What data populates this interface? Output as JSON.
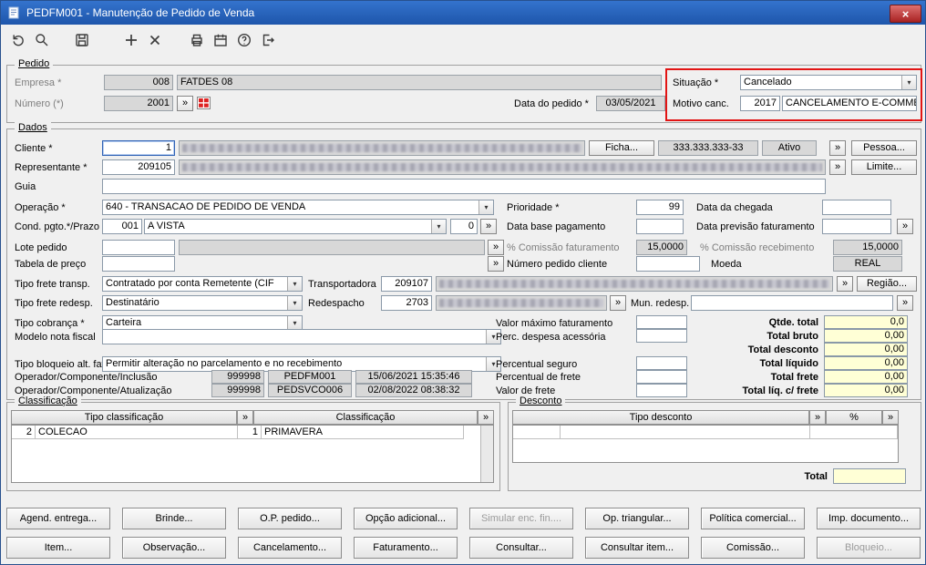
{
  "glyphs": {
    "more": "»",
    "chevron": "▾",
    "close": "×"
  },
  "window": {
    "title": "PEDFM001 - Manutenção de Pedido de Venda"
  },
  "toolbar": {
    "icons": [
      "undo-icon",
      "search-icon",
      "save-icon",
      "add-icon",
      "delete-icon",
      "print-icon",
      "calendar-icon",
      "help-icon",
      "exit-icon"
    ]
  },
  "pedido": {
    "title": "Pedido",
    "empresa_label": "Empresa *",
    "empresa_code": "008",
    "empresa_name": "FATDES 08",
    "numero_label": "Número (*)",
    "numero_value": "2001",
    "data_pedido_label": "Data do pedido *",
    "data_pedido_value": "03/05/2021",
    "situacao_label": "Situação *",
    "situacao_value": "Cancelado",
    "motivo_label": "Motivo canc.",
    "motivo_code": "2017",
    "motivo_text": "CANCELAMENTO E-COMMER"
  },
  "dados": {
    "title": "Dados",
    "cliente_label": "Cliente *",
    "cliente_code": "1",
    "ficha_button": "Ficha...",
    "cliente_documento": "333.333.333-33",
    "cliente_status": "Ativo",
    "pessoa_button": "Pessoa...",
    "representante_label": "Representante *",
    "representante_code": "209105",
    "limite_button": "Limite...",
    "guia_label": "Guia",
    "operacao_label": "Operação *",
    "operacao_value": "640 - TRANSACAO DE PEDIDO DE VENDA",
    "prioridade_label": "Prioridade *",
    "prioridade_value": "99",
    "data_chegada_label": "Data da chegada",
    "cond_pgto_label": "Cond. pgto.*/Prazo",
    "cond_pgto_code": "001",
    "cond_pgto_value": "A VISTA",
    "prazo_value": "0",
    "data_base_label": "Data base pagamento",
    "data_previsao_label": "Data previsão faturamento",
    "lote_label": "Lote pedido",
    "comissao_fat_label": "% Comissão faturamento",
    "comissao_fat_value": "15,0000",
    "comissao_rec_label": "% Comissão recebimento",
    "comissao_rec_value": "15,0000",
    "tabela_preco_label": "Tabela de preço",
    "num_pedido_cliente_label": "Número pedido cliente",
    "moeda_label": "Moeda",
    "moeda_value": "REAL",
    "frete_transp_label": "Tipo frete transp.",
    "frete_transp_value": "Contratado por conta Remetente (CIF",
    "transportadora_label": "Transportadora",
    "transportadora_code": "209107",
    "regiao_button": "Região...",
    "frete_redesp_label": "Tipo frete redesp.",
    "frete_redesp_value": "Destinatário",
    "redespacho_label": "Redespacho",
    "redespacho_code": "2703",
    "mun_redesp_label": "Mun. redesp.",
    "cobranca_label": "Tipo cobrança *",
    "cobranca_value": "Carteira",
    "valor_max_label": "Valor máximo faturamento",
    "modelo_nf_label": "Modelo nota fiscal",
    "perc_despesa_label": "Perc. despesa acessória",
    "bloqueio_label": "Tipo bloqueio alt. fat.",
    "bloqueio_value": "Permitir alteração no parcelamento e no recebimento",
    "perc_seguro_label": "Percentual seguro",
    "perc_frete_label": "Percentual de frete",
    "valor_frete_label": "Valor de frete",
    "inclusao_label": "Operador/Componente/Inclusão",
    "inclusao_operador": "999998",
    "inclusao_componente": "PEDFM001",
    "inclusao_datahora": "15/06/2021 15:35:46",
    "atualizacao_label": "Operador/Componente/Atualização",
    "atualizacao_operador": "999998",
    "atualizacao_componente": "PEDSVCO006",
    "atualizacao_datahora": "02/08/2022 08:38:32",
    "totais": {
      "qtde_label": "Qtde. total",
      "qtde_value": "0,0",
      "bruto_label": "Total bruto",
      "bruto_value": "0,00",
      "desconto_label": "Total desconto",
      "desconto_value": "0,00",
      "liquido_label": "Total líquido",
      "liquido_value": "0,00",
      "frete_label": "Total frete",
      "frete_value": "0,00",
      "liq_frete_label": "Total líq. c/ frete",
      "liq_frete_value": "0,00"
    }
  },
  "classificacao": {
    "title": "Classificação",
    "header_tipo": "Tipo classificação",
    "header_class": "Classificação",
    "row": {
      "tipo_cod": "2",
      "tipo_nome": "COLECAO",
      "class_cod": "1",
      "class_nome": "PRIMAVERA"
    }
  },
  "desconto": {
    "title": "Desconto",
    "header_tipo": "Tipo desconto",
    "header_pct": "%",
    "total_label": "Total"
  },
  "buttons_row1": [
    "Agend. entrega...",
    "Brinde...",
    "O.P. pedido...",
    "Opção adicional...",
    "Simular enc. fin....",
    "Op. triangular...",
    "Política comercial...",
    "Imp. documento..."
  ],
  "buttons_row2": [
    "Item...",
    "Observação...",
    "Cancelamento...",
    "Faturamento...",
    "Consultar...",
    "Consultar item...",
    "Comissão...",
    "Bloqueio..."
  ]
}
